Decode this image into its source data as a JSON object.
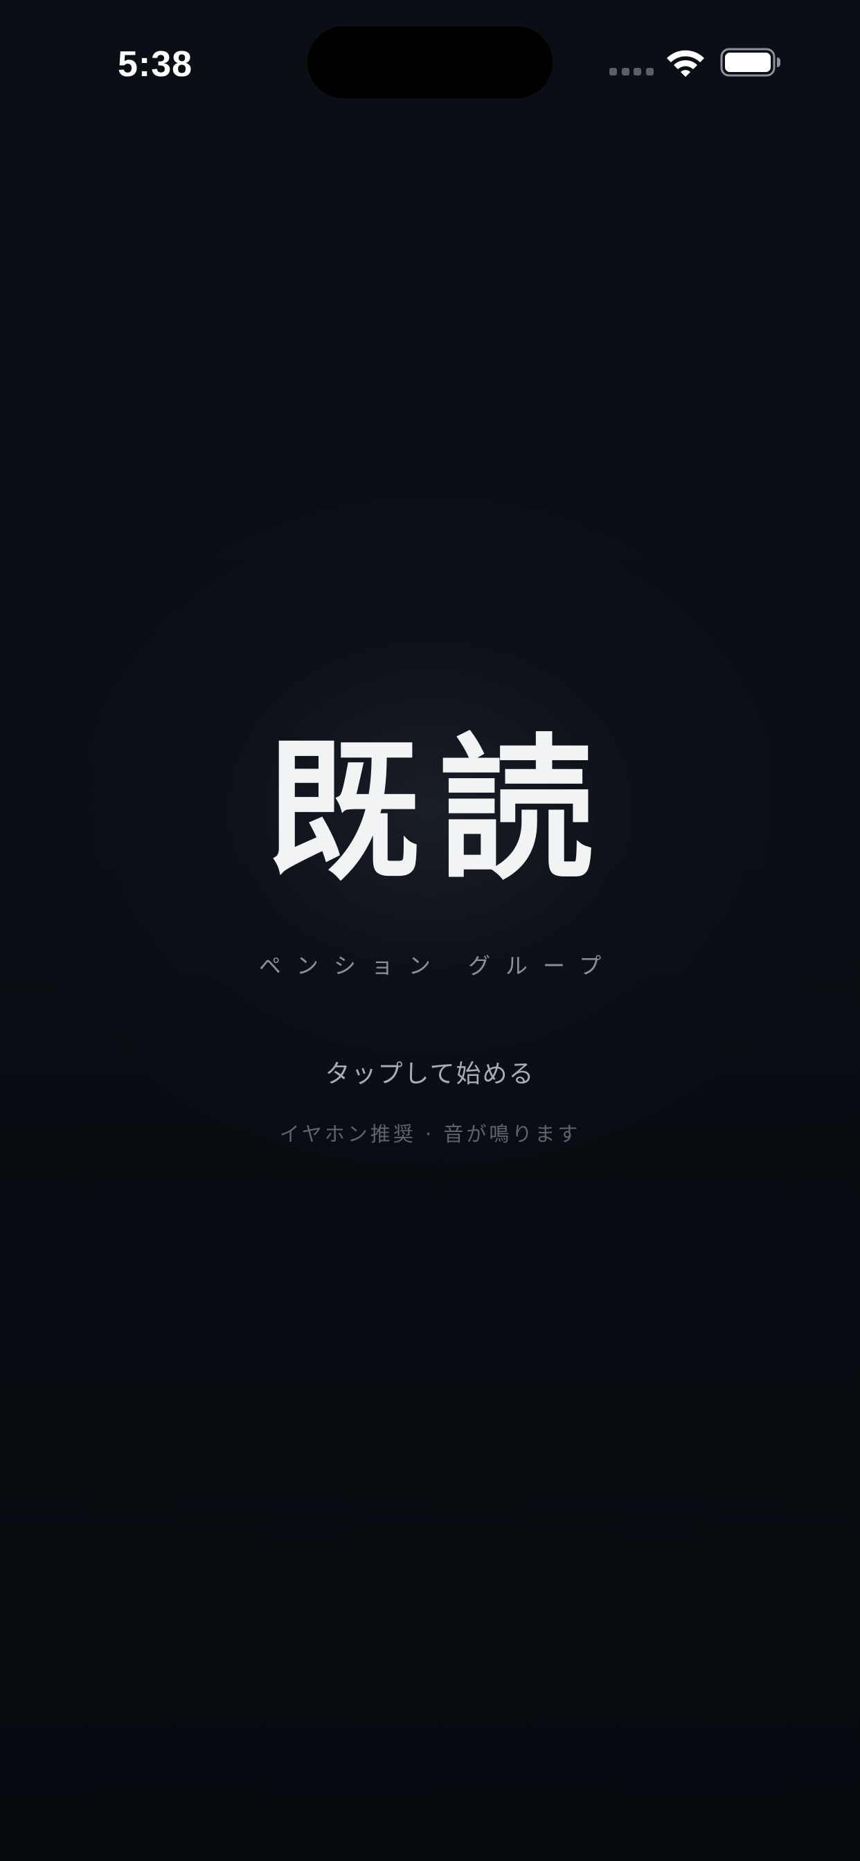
{
  "status_bar": {
    "time": "5:38",
    "icons": [
      "cellular-signal-icon",
      "wifi-icon",
      "battery-icon"
    ]
  },
  "title_screen": {
    "title": "既読",
    "subtitle": "ペンション グループ",
    "start_prompt": "タップして始める",
    "earphone_note": "イヤホン推奨 · 音が鳴ります"
  },
  "colors": {
    "background": "#0a0d12",
    "title": "#f2f3f5",
    "subtitle": "#8b9098",
    "prompt": "#a8adb5",
    "note": "#5f646c"
  }
}
